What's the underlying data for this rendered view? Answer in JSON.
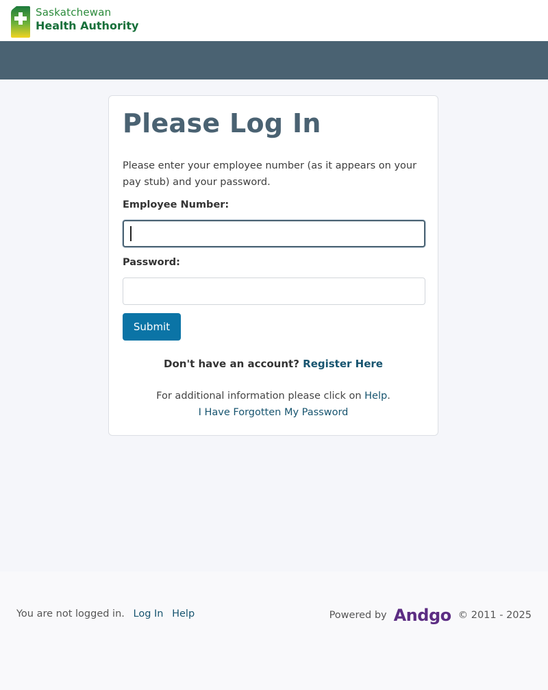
{
  "brand": {
    "line1": "Saskatchewan",
    "line2": "Health Authority"
  },
  "login": {
    "title": "Please Log In",
    "intro": "Please enter your employee number (as it appears on your pay stub) and your password.",
    "employee_label": "Employee Number:",
    "employee_value": "",
    "password_label": "Password:",
    "password_value": "",
    "submit_label": "Submit",
    "register_prompt": "Don't have an account?",
    "register_link": "Register Here",
    "help_text": "For additional information please click on",
    "help_link": "Help",
    "help_suffix": ".",
    "forgot_link": "I Have Forgotten My Password"
  },
  "footer": {
    "status": "You are not logged in.",
    "login_link": "Log In",
    "help_link": "Help",
    "powered_by": "Powered by",
    "vendor": "Andgo",
    "copyright": "© 2011 - 2025"
  },
  "colors": {
    "nav_band": "#4a6272",
    "primary_button": "#0b74a6",
    "link": "#17546f",
    "vendor": "#5c2d83"
  }
}
